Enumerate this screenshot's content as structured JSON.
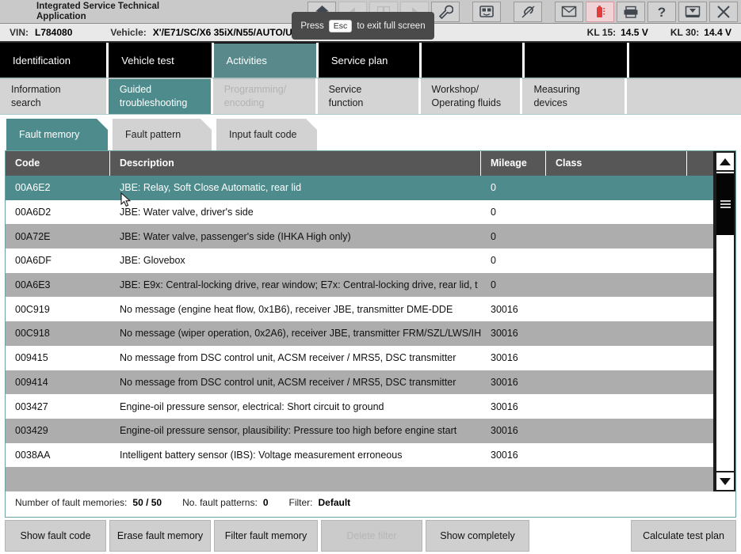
{
  "app": {
    "title_line1": "Integrated Service Technical",
    "title_line2": "Application"
  },
  "toast": {
    "prefix": "Press",
    "key": "Esc",
    "suffix": "to exit full screen"
  },
  "toolbar": {
    "icons": [
      {
        "name": "home-icon",
        "label": "Home"
      },
      {
        "name": "back-icon",
        "label": "Back"
      },
      {
        "name": "copy-icon",
        "label": "Copy"
      },
      {
        "name": "forward-icon",
        "label": "Forward"
      },
      {
        "name": "wrench-icon",
        "label": "Service"
      },
      {
        "name": "connection-icon",
        "label": "Connection"
      },
      {
        "name": "link-icon",
        "label": "Link"
      },
      {
        "name": "mail-icon",
        "label": "Messages"
      },
      {
        "name": "battery-icon",
        "label": "Battery"
      },
      {
        "name": "printer-icon",
        "label": "Print"
      },
      {
        "name": "help-icon",
        "label": "Help"
      },
      {
        "name": "minimize-icon",
        "label": "Minimize"
      },
      {
        "name": "close-icon",
        "label": "Close"
      }
    ]
  },
  "vehicle_bar": {
    "vin_label": "VIN:",
    "vin_value": "L784080",
    "vehicle_label": "Vehicle:",
    "vehicle_value": "X'/E71/SC/X6 35iX/N55/AUTO/USA/LL/2012/04",
    "kl15_label": "KL 15:",
    "kl15_value": "14.5 V",
    "kl30_label": "KL 30:",
    "kl30_value": "14.4 V"
  },
  "nav_primary": [
    {
      "label": "Identification",
      "active": false
    },
    {
      "label": "Vehicle test",
      "active": false
    },
    {
      "label": "Activities",
      "active": true
    },
    {
      "label": "Service plan",
      "active": false
    },
    {
      "label": "",
      "active": false
    },
    {
      "label": "",
      "active": false
    },
    {
      "label": "",
      "active": false
    }
  ],
  "nav_secondary": [
    {
      "line1": "Information",
      "line2": "search",
      "active": false,
      "disabled": false
    },
    {
      "line1": "Guided",
      "line2": "troubleshooting",
      "active": true,
      "disabled": false
    },
    {
      "line1": "Programming/",
      "line2": "encoding",
      "active": false,
      "disabled": true
    },
    {
      "line1": "Service",
      "line2": "function",
      "active": false,
      "disabled": false
    },
    {
      "line1": "Workshop/",
      "line2": "Operating fluids",
      "active": false,
      "disabled": false
    },
    {
      "line1": "Measuring",
      "line2": "devices",
      "active": false,
      "disabled": false
    },
    {
      "line1": "",
      "line2": "",
      "active": false,
      "disabled": false
    }
  ],
  "nav_tabs": [
    {
      "label": "Fault memory",
      "active": true
    },
    {
      "label": "Fault pattern",
      "active": false
    },
    {
      "label": "Input fault code",
      "active": false
    }
  ],
  "table": {
    "columns": [
      "Code",
      "Description",
      "Mileage",
      "Class"
    ],
    "rows": [
      {
        "code": "00A6E2",
        "description": "JBE: Relay, Soft Close Automatic, rear lid",
        "mileage": "0",
        "class": "",
        "selected": true
      },
      {
        "code": "00A6D2",
        "description": "JBE: Water valve, driver's side",
        "mileage": "0",
        "class": "",
        "selected": false
      },
      {
        "code": "00A72E",
        "description": "JBE: Water valve, passenger's side (IHKA High only)",
        "mileage": "0",
        "class": "",
        "selected": false
      },
      {
        "code": "00A6DF",
        "description": "JBE: Glovebox",
        "mileage": "0",
        "class": "",
        "selected": false
      },
      {
        "code": "00A6E3",
        "description": "JBE: E9x: Central-locking drive, rear window; E7x: Central-locking drive, rear lid, t",
        "mileage": "0",
        "class": "",
        "selected": false
      },
      {
        "code": "00C919",
        "description": "No message (engine heat flow, 0x1B6), receiver JBE, transmitter DME-DDE",
        "mileage": "30016",
        "class": "",
        "selected": false
      },
      {
        "code": "00C918",
        "description": "No message (wiper operation, 0x2A6), receiver JBE, transmitter FRM/SZL/LWS/IH",
        "mileage": "30016",
        "class": "",
        "selected": false
      },
      {
        "code": "009415",
        "description": "No message from DSC control unit, ACSM receiver / MRS5, DSC transmitter",
        "mileage": "30016",
        "class": "",
        "selected": false
      },
      {
        "code": "009414",
        "description": "No message from DSC control unit, ACSM receiver / MRS5, DSC transmitter",
        "mileage": "30016",
        "class": "",
        "selected": false
      },
      {
        "code": "003427",
        "description": "Engine-oil pressure sensor, electrical: Short circuit to ground",
        "mileage": "30016",
        "class": "",
        "selected": false
      },
      {
        "code": "003429",
        "description": "Engine-oil pressure sensor, plausibility: Pressure too high before engine start",
        "mileage": "30016",
        "class": "",
        "selected": false
      },
      {
        "code": "0038AA",
        "description": "Intelligent battery sensor (IBS): Voltage measurement erroneous",
        "mileage": "30016",
        "class": "",
        "selected": false
      },
      {
        "code": "",
        "description": "",
        "mileage": "",
        "class": "",
        "selected": false
      }
    ]
  },
  "status": {
    "count_label": "Number of fault memories:",
    "count_value": "50 / 50",
    "patterns_label": "No. fault patterns:",
    "patterns_value": "0",
    "filter_label": "Filter:",
    "filter_value": "Default"
  },
  "action_buttons": [
    {
      "label": "Show fault code",
      "disabled": false
    },
    {
      "label": "Erase fault memory",
      "disabled": false
    },
    {
      "label": "Filter fault memory",
      "disabled": false
    },
    {
      "label": "Delete filter",
      "disabled": true
    },
    {
      "label": "Show completely",
      "disabled": false
    },
    {
      "label": "Calculate test plan",
      "disabled": false
    }
  ],
  "colors": {
    "accent_teal": "#4e8b8c",
    "nav_black": "#000000",
    "header_gray": "#575757",
    "row_alt": "#adadad",
    "toolbar_gray": "#c9c9c9"
  }
}
